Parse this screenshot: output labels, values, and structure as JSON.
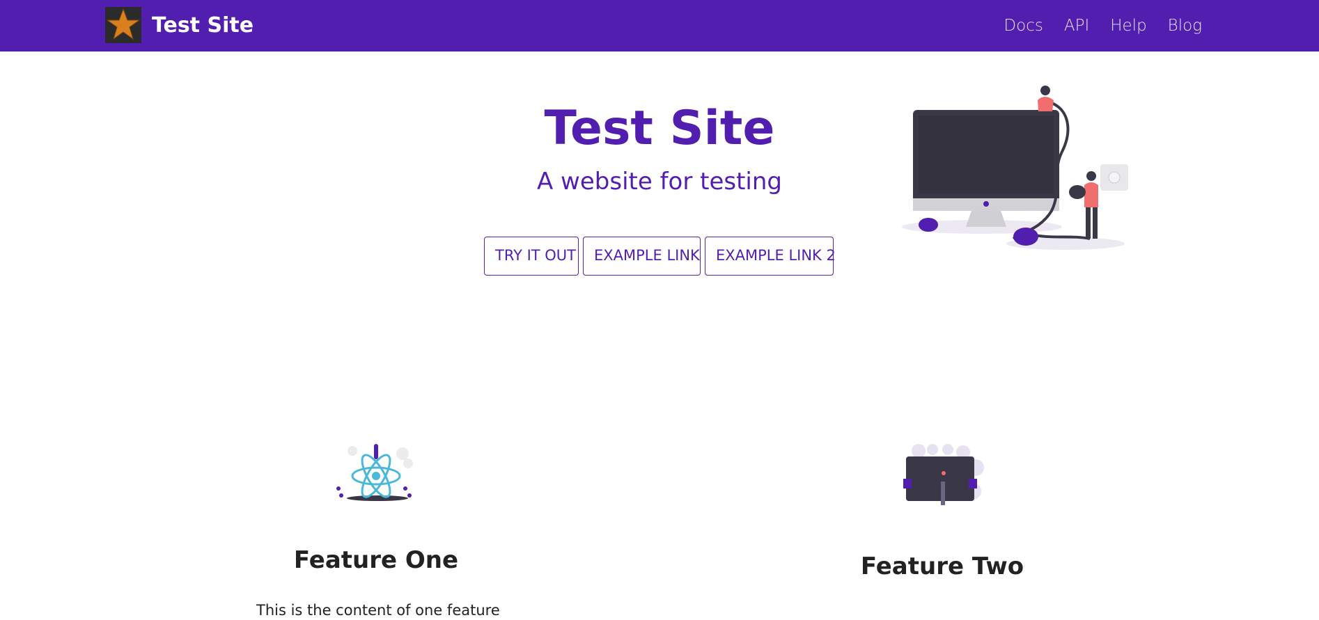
{
  "navbar": {
    "brand": "Test Site",
    "links": [
      "Docs",
      "API",
      "Help",
      "Blog"
    ]
  },
  "hero": {
    "title": "Test Site",
    "subtitle": "A website for testing",
    "buttons": [
      "TRY IT OUT",
      "EXAMPLE LINK",
      "EXAMPLE LINK 2"
    ]
  },
  "features": [
    {
      "title": "Feature One",
      "text": "This is the content of one feature"
    },
    {
      "title": "Feature Two"
    }
  ],
  "colors": {
    "primary": "#521eb0",
    "text": "#222222",
    "background": "#ffffff"
  },
  "icons": {
    "logo": "star-logo-icon",
    "hero": "computer-plug-illustration",
    "feature_one": "react-atom-rocket-illustration",
    "feature_two": "laptop-person-illustration"
  }
}
